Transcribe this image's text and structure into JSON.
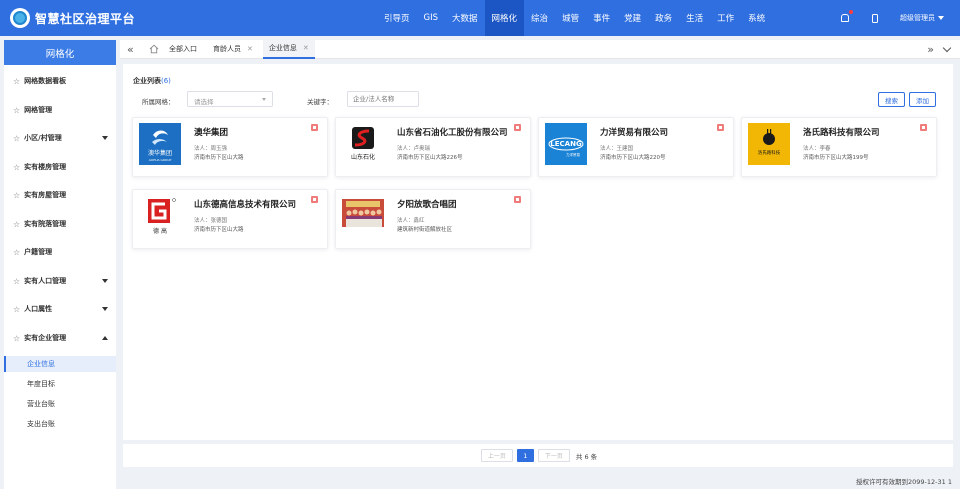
{
  "header": {
    "title": "智慧社区治理平台",
    "nav": [
      "引导页",
      "GIS",
      "大数据",
      "网格化",
      "综治",
      "城管",
      "事件",
      "党建",
      "政务",
      "生活",
      "工作",
      "系统"
    ],
    "active_nav": 3,
    "user": "超级管理员",
    "icons": [
      "bell-icon",
      "phone-icon",
      "caret-down-icon"
    ]
  },
  "sidebar": {
    "title": "网格化",
    "items": [
      {
        "label": "网格数据看板",
        "caret": "none"
      },
      {
        "label": "网格管理",
        "caret": "none"
      },
      {
        "label": "小区/村管理",
        "caret": "down"
      },
      {
        "label": "实有楼房管理",
        "caret": "none"
      },
      {
        "label": "实有房屋管理",
        "caret": "none"
      },
      {
        "label": "实有院落管理",
        "caret": "none"
      },
      {
        "label": "户籍管理",
        "caret": "none"
      },
      {
        "label": "实有人口管理",
        "caret": "down"
      },
      {
        "label": "人口属性",
        "caret": "down"
      },
      {
        "label": "实有企业管理",
        "caret": "up"
      }
    ],
    "sub_items": [
      "企业信息",
      "年度目标",
      "营业台账",
      "支出台账"
    ],
    "active_sub": 0
  },
  "tabbar": {
    "tabs": [
      {
        "label": "全部入口",
        "closable": false
      },
      {
        "label": "育龄人员",
        "closable": true
      },
      {
        "label": "企业信息",
        "closable": true
      }
    ],
    "active_tab": 2
  },
  "main": {
    "list_title": "企业列表",
    "count": "(6)",
    "filter_grid_label": "所属网格：",
    "filter_grid_placeholder": "请选择",
    "keyword_label": "关键字：",
    "keyword_placeholder": "企业/法人名称",
    "search_label": "搜索",
    "add_label": "添加"
  },
  "companies": [
    {
      "name": "澳华集团",
      "legal": "法人：周玉强",
      "address": "济南市历下区山大路",
      "logo": "aohua"
    },
    {
      "name": "山东省石油化工股份有限公司",
      "legal": "法人：卢奥瑞",
      "address": "济南市历下区山大路226号",
      "logo": "shihua"
    },
    {
      "name": "力洋贸易有限公司",
      "legal": "法人：王建国",
      "address": "济南市历下区山大路220号",
      "logo": "lichuang"
    },
    {
      "name": "洛氏路科技有限公司",
      "legal": "法人：李春",
      "address": "济南市历下区山大路199号",
      "logo": "luo"
    },
    {
      "name": "山东德高信息技术有限公司",
      "legal": "法人：张德国",
      "address": "济南市历下区山大路",
      "logo": "dexin"
    },
    {
      "name": "夕阳放歌合唱团",
      "legal": "法人：鑫红",
      "address": "建筑新村街道解放社区",
      "logo": "photo"
    }
  ],
  "logo_text": {
    "aohua": "澳华集团",
    "aohua_en": "AOHUA GROUP",
    "shihua": "山东石化",
    "lichuang": "LECANG",
    "lichuang_cn": "力洋贸易",
    "luo": "洛氏路科技",
    "dexin": "德 高"
  },
  "pager": {
    "prev": "上一页",
    "current": "1",
    "next": "下一页",
    "total": "共 6 条"
  },
  "footer": {
    "license": "授权许可有效期到2099-12-31 1"
  },
  "colors": {
    "primary": "#2f6fe0",
    "header_bg": "#2f6fe0",
    "active_nav_bg": "#1c56c4",
    "delete": "#f07b7b"
  }
}
